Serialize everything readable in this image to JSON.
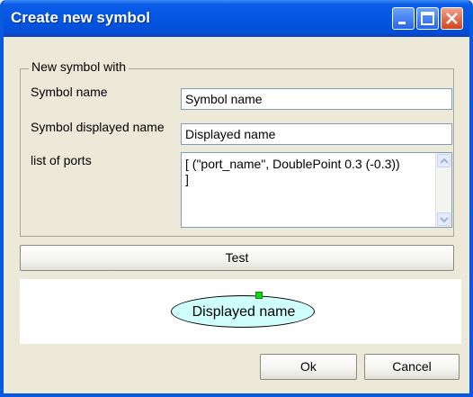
{
  "window": {
    "title": "Create new symbol"
  },
  "form": {
    "group_label": "New symbol with",
    "symbol_name_label": "Symbol name",
    "symbol_name_value": "Symbol name",
    "displayed_name_label": "Symbol displayed name",
    "displayed_name_value": "Displayed name",
    "ports_label": "list of ports",
    "ports_value": "[ (\"port_name\", DoublePoint 0.3 (-0.3))\n]"
  },
  "buttons": {
    "test": "Test",
    "ok": "Ok",
    "cancel": "Cancel"
  },
  "preview": {
    "symbol_text": "Displayed name",
    "symbol_fill": "#cffffc",
    "port_color": "#17d315"
  },
  "colors": {
    "titlebar": "#0456e3",
    "dialog_bg": "#ece9d8"
  }
}
